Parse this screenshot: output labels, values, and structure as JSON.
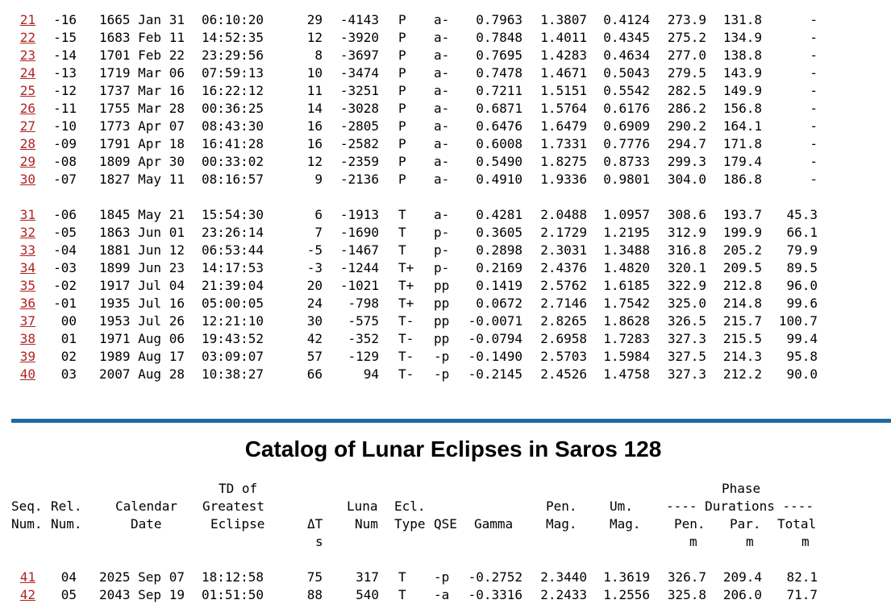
{
  "upper_rows": [
    [
      "21",
      "-16",
      "1665 Jan 31",
      "06:10:20",
      "29",
      "-4143",
      "P",
      "a-",
      "0.7963",
      "1.3807",
      "0.4124",
      "273.9",
      "131.8",
      "-"
    ],
    [
      "22",
      "-15",
      "1683 Feb 11",
      "14:52:35",
      "12",
      "-3920",
      "P",
      "a-",
      "0.7848",
      "1.4011",
      "0.4345",
      "275.2",
      "134.9",
      "-"
    ],
    [
      "23",
      "-14",
      "1701 Feb 22",
      "23:29:56",
      "8",
      "-3697",
      "P",
      "a-",
      "0.7695",
      "1.4283",
      "0.4634",
      "277.0",
      "138.8",
      "-"
    ],
    [
      "24",
      "-13",
      "1719 Mar 06",
      "07:59:13",
      "10",
      "-3474",
      "P",
      "a-",
      "0.7478",
      "1.4671",
      "0.5043",
      "279.5",
      "143.9",
      "-"
    ],
    [
      "25",
      "-12",
      "1737 Mar 16",
      "16:22:12",
      "11",
      "-3251",
      "P",
      "a-",
      "0.7211",
      "1.5151",
      "0.5542",
      "282.5",
      "149.9",
      "-"
    ],
    [
      "26",
      "-11",
      "1755 Mar 28",
      "00:36:25",
      "14",
      "-3028",
      "P",
      "a-",
      "0.6871",
      "1.5764",
      "0.6176",
      "286.2",
      "156.8",
      "-"
    ],
    [
      "27",
      "-10",
      "1773 Apr 07",
      "08:43:30",
      "16",
      "-2805",
      "P",
      "a-",
      "0.6476",
      "1.6479",
      "0.6909",
      "290.2",
      "164.1",
      "-"
    ],
    [
      "28",
      "-09",
      "1791 Apr 18",
      "16:41:28",
      "16",
      "-2582",
      "P",
      "a-",
      "0.6008",
      "1.7331",
      "0.7776",
      "294.7",
      "171.8",
      "-"
    ],
    [
      "29",
      "-08",
      "1809 Apr 30",
      "00:33:02",
      "12",
      "-2359",
      "P",
      "a-",
      "0.5490",
      "1.8275",
      "0.8733",
      "299.3",
      "179.4",
      "-"
    ],
    [
      "30",
      "-07",
      "1827 May 11",
      "08:16:57",
      "9",
      "-2136",
      "P",
      "a-",
      "0.4910",
      "1.9336",
      "0.9801",
      "304.0",
      "186.8",
      "-"
    ],
    [
      "31",
      "-06",
      "1845 May 21",
      "15:54:30",
      "6",
      "-1913",
      "T",
      "a-",
      "0.4281",
      "2.0488",
      "1.0957",
      "308.6",
      "193.7",
      "45.3"
    ],
    [
      "32",
      "-05",
      "1863 Jun 01",
      "23:26:14",
      "7",
      "-1690",
      "T",
      "p-",
      "0.3605",
      "2.1729",
      "1.2195",
      "312.9",
      "199.9",
      "66.1"
    ],
    [
      "33",
      "-04",
      "1881 Jun 12",
      "06:53:44",
      "-5",
      "-1467",
      "T",
      "p-",
      "0.2898",
      "2.3031",
      "1.3488",
      "316.8",
      "205.2",
      "79.9"
    ],
    [
      "34",
      "-03",
      "1899 Jun 23",
      "14:17:53",
      "-3",
      "-1244",
      "T+",
      "p-",
      "0.2169",
      "2.4376",
      "1.4820",
      "320.1",
      "209.5",
      "89.5"
    ],
    [
      "35",
      "-02",
      "1917 Jul 04",
      "21:39:04",
      "20",
      "-1021",
      "T+",
      "pp",
      "0.1419",
      "2.5762",
      "1.6185",
      "322.9",
      "212.8",
      "96.0"
    ],
    [
      "36",
      "-01",
      "1935 Jul 16",
      "05:00:05",
      "24",
      "-798",
      "T+",
      "pp",
      "0.0672",
      "2.7146",
      "1.7542",
      "325.0",
      "214.8",
      "99.6"
    ],
    [
      "37",
      "00",
      "1953 Jul 26",
      "12:21:10",
      "30",
      "-575",
      "T-",
      "pp",
      "-0.0071",
      "2.8265",
      "1.8628",
      "326.5",
      "215.7",
      "100.7"
    ],
    [
      "38",
      "01",
      "1971 Aug 06",
      "19:43:52",
      "42",
      "-352",
      "T-",
      "pp",
      "-0.0794",
      "2.6958",
      "1.7283",
      "327.3",
      "215.5",
      "99.4"
    ],
    [
      "39",
      "02",
      "1989 Aug 17",
      "03:09:07",
      "57",
      "-129",
      "T-",
      "-p",
      "-0.1490",
      "2.5703",
      "1.5984",
      "327.5",
      "214.3",
      "95.8"
    ],
    [
      "40",
      "03",
      "2007 Aug 28",
      "10:38:27",
      "66",
      "94",
      "T-",
      "-p",
      "-0.2145",
      "2.4526",
      "1.4758",
      "327.3",
      "212.2",
      "90.0"
    ]
  ],
  "catalog_title": "Catalog of Lunar Eclipses in Saros 128",
  "header": {
    "seq1": "Seq.",
    "seq2": "Num.",
    "rel1": "Rel.",
    "rel2": "Num.",
    "cal1": "Calendar",
    "cal2": "Date",
    "td1": "TD of",
    "td2": "Greatest",
    "td3": "Eclipse",
    "dt1": "ΔT",
    "dt2": "s",
    "luna1": "Luna",
    "luna2": "Num",
    "ecl1": "Ecl.",
    "ecl2": "Type",
    "qse": "QSE",
    "gamma": "Gamma",
    "pen1": "Pen.",
    "pen2": "Mag.",
    "um1": "Um.",
    "um2": "Mag.",
    "phase": "Phase",
    "durations": "---- Durations ----",
    "dpen": "Pen.",
    "dpar": "Par.",
    "dtot": "Total",
    "m1": "m",
    "m2": "m",
    "m3": "m"
  },
  "lower_rows": [
    [
      "41",
      "04",
      "2025 Sep 07",
      "18:12:58",
      "75",
      "317",
      "T",
      "-p",
      "-0.2752",
      "2.3440",
      "1.3619",
      "326.7",
      "209.4",
      "82.1"
    ],
    [
      "42",
      "05",
      "2043 Sep 19",
      "01:51:50",
      "88",
      "540",
      "T",
      "-a",
      "-0.3316",
      "2.2433",
      "1.2556",
      "325.8",
      "206.0",
      "71.7"
    ]
  ]
}
